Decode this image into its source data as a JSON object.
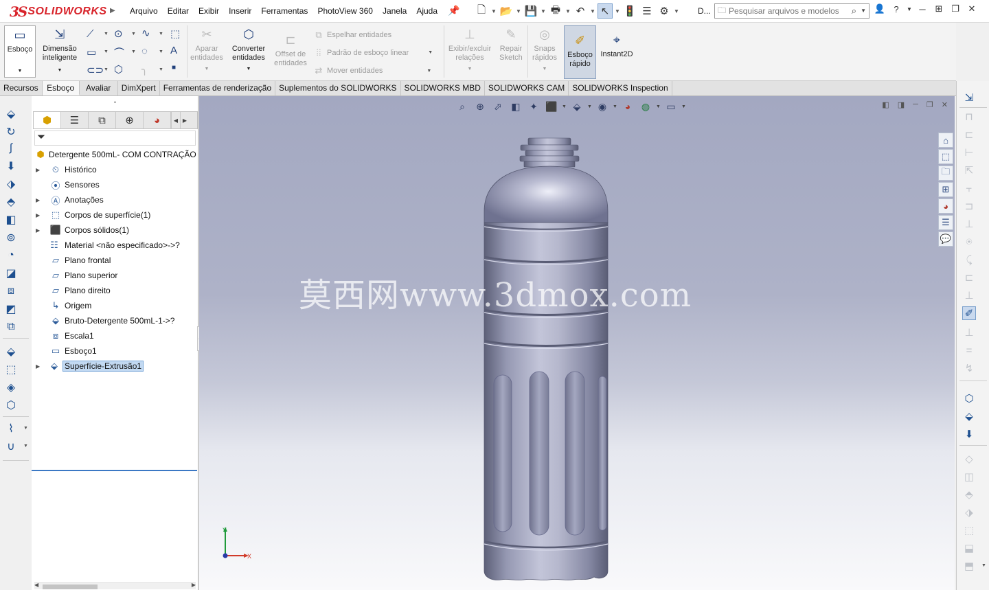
{
  "app": {
    "logo_ds": "3S",
    "logo_name": "SOLIDWORKS",
    "menu": [
      "Arquivo",
      "Editar",
      "Exibir",
      "Inserir",
      "Ferramentas",
      "PhotoView 360",
      "Janela",
      "Ajuda"
    ],
    "doc_abbr": "D...",
    "search_placeholder": "Pesquisar arquivos e modelos"
  },
  "ribbon": {
    "esboco": "Esboço",
    "dimensao": "Dimensão inteligente",
    "aparar": "Aparar entidades",
    "converter": "Converter entidades",
    "offset": "Offset de entidades",
    "espelhar": "Espelhar entidades",
    "padrao": "Padrão de esboço linear",
    "mover": "Mover entidades",
    "exibir_relacoes": "Exibir/excluir relações",
    "repair": "Repair Sketch",
    "snaps": "Snaps rápidos",
    "esboco_rapido": "Esboço rápido",
    "instant2d": "Instant2D"
  },
  "tabs": [
    "Recursos",
    "Esboço",
    "Avaliar",
    "DimXpert",
    "Ferramentas de renderização",
    "Suplementos do SOLIDWORKS",
    "SOLIDWORKS MBD",
    "SOLIDWORKS CAM",
    "SOLIDWORKS Inspection"
  ],
  "active_tab": "Esboço",
  "tree": {
    "root": "Detergente 500mL- COM CONTRAÇÃO",
    "items": [
      {
        "label": "Histórico",
        "icon": "history-icon",
        "expandable": true
      },
      {
        "label": "Sensores",
        "icon": "sensor-icon",
        "expandable": false
      },
      {
        "label": "Anotações",
        "icon": "annotation-icon",
        "expandable": true
      },
      {
        "label": "Corpos de superfície(1)",
        "icon": "surface-body-icon",
        "expandable": true
      },
      {
        "label": "Corpos sólidos(1)",
        "icon": "solid-body-icon",
        "expandable": true
      },
      {
        "label": "Material <não especificado>->?",
        "icon": "material-icon",
        "expandable": false
      },
      {
        "label": "Plano frontal",
        "icon": "plane-icon",
        "expandable": false
      },
      {
        "label": "Plano superior",
        "icon": "plane-icon",
        "expandable": false
      },
      {
        "label": "Plano direito",
        "icon": "plane-icon",
        "expandable": false
      },
      {
        "label": "Origem",
        "icon": "origin-icon",
        "expandable": false
      },
      {
        "label": "Bruto-Detergente 500mL-1->?",
        "icon": "part-icon",
        "expandable": false
      },
      {
        "label": "Escala1",
        "icon": "scale-icon",
        "expandable": false
      },
      {
        "label": "Esboço1",
        "icon": "sketch-icon",
        "expandable": false
      },
      {
        "label": "Superfície-Extrusão1",
        "icon": "extrude-surface-icon",
        "expandable": true,
        "selected": true
      }
    ]
  },
  "viewport": {
    "watermark": "莫西网www.3dmox.com",
    "triad_x": "X",
    "triad_y": "Y"
  },
  "colors": {
    "brand": "#d8232a",
    "accent": "#3b78c4",
    "selection": "#c2d9f2"
  }
}
